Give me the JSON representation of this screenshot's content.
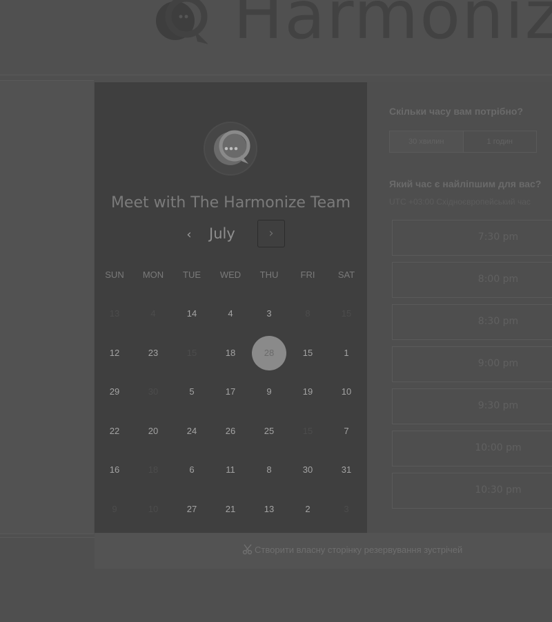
{
  "header": {
    "logo_text": "Harmonize"
  },
  "calendar": {
    "title": "Meet with The Harmonize Team",
    "month": "July",
    "prev_glyph": "‹",
    "next_glyph": "›",
    "weekdays": [
      "SUN",
      "MON",
      "TUE",
      "WED",
      "THU",
      "FRI",
      "SAT"
    ],
    "weeks": [
      [
        "13",
        "4",
        "14",
        "4",
        "3",
        "8",
        "15"
      ],
      [
        "12",
        "23",
        "15",
        "18",
        "28",
        "15",
        "1"
      ],
      [
        "29",
        "30",
        "5",
        "17",
        "9",
        "19",
        "10"
      ],
      [
        "22",
        "20",
        "24",
        "26",
        "25",
        "15",
        "7"
      ],
      [
        "16",
        "18",
        "6",
        "11",
        "8",
        "30",
        "31"
      ],
      [
        "9",
        "10",
        "27",
        "21",
        "13",
        "2",
        "3"
      ]
    ],
    "muted": [
      [
        0,
        0
      ],
      [
        0,
        1
      ],
      [
        0,
        5
      ],
      [
        0,
        6
      ],
      [
        1,
        2
      ],
      [
        2,
        1
      ],
      [
        3,
        5
      ],
      [
        4,
        1
      ],
      [
        5,
        0
      ],
      [
        5,
        1
      ],
      [
        5,
        6
      ]
    ],
    "selected": [
      1,
      4
    ]
  },
  "booking": {
    "duration_question": "Скільки часу вам потрібно?",
    "durations": [
      "30 хвилин",
      "1 годин"
    ],
    "time_question": "Який час є найліпшим для вас?",
    "timezone": "UTC +03:00 Східноєвропейський час",
    "slots": [
      "7:30 pm",
      "8:00 pm",
      "8:30 pm",
      "9:00 pm",
      "9:30 pm",
      "10:00 pm",
      "10:30 pm"
    ]
  },
  "footer": {
    "link": "Створити власну сторінку резервування зустрічей"
  }
}
